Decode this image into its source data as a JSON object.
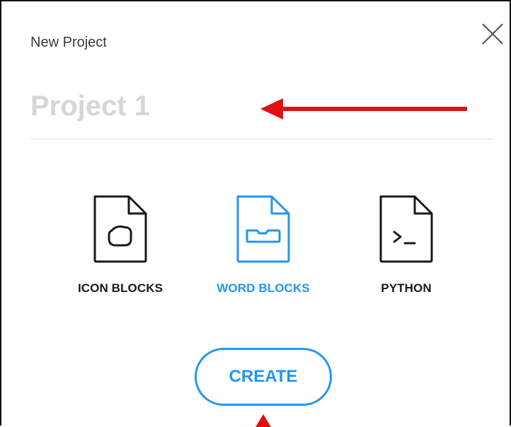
{
  "dialog": {
    "title": "New Project",
    "close_icon": "close-icon",
    "project_name": {
      "placeholder": "Project 1",
      "value": ""
    },
    "options": [
      {
        "label": "ICON BLOCKS",
        "icon": "file-icon-blocks-icon",
        "selected": false
      },
      {
        "label": "WORD BLOCKS",
        "icon": "file-word-blocks-icon",
        "selected": true
      },
      {
        "label": "PYTHON",
        "icon": "file-python-icon",
        "selected": false
      }
    ],
    "create_label": "CREATE"
  },
  "colors": {
    "accent": "#2196f3",
    "annotation_arrow": "#e01010",
    "text": "#1a1a1a",
    "placeholder": "#d6d6d6"
  }
}
